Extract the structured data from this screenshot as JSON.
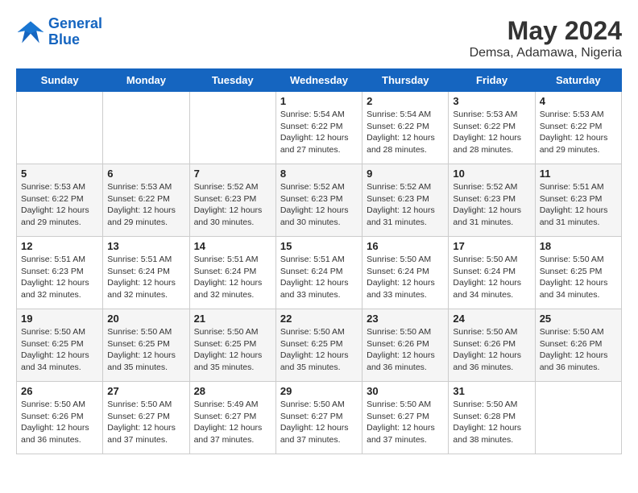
{
  "logo": {
    "line1": "General",
    "line2": "Blue"
  },
  "title": {
    "month_year": "May 2024",
    "location": "Demsa, Adamawa, Nigeria"
  },
  "days_of_week": [
    "Sunday",
    "Monday",
    "Tuesday",
    "Wednesday",
    "Thursday",
    "Friday",
    "Saturday"
  ],
  "weeks": [
    [
      {
        "day": "",
        "info": ""
      },
      {
        "day": "",
        "info": ""
      },
      {
        "day": "",
        "info": ""
      },
      {
        "day": "1",
        "info": "Sunrise: 5:54 AM\nSunset: 6:22 PM\nDaylight: 12 hours\nand 27 minutes."
      },
      {
        "day": "2",
        "info": "Sunrise: 5:54 AM\nSunset: 6:22 PM\nDaylight: 12 hours\nand 28 minutes."
      },
      {
        "day": "3",
        "info": "Sunrise: 5:53 AM\nSunset: 6:22 PM\nDaylight: 12 hours\nand 28 minutes."
      },
      {
        "day": "4",
        "info": "Sunrise: 5:53 AM\nSunset: 6:22 PM\nDaylight: 12 hours\nand 29 minutes."
      }
    ],
    [
      {
        "day": "5",
        "info": "Sunrise: 5:53 AM\nSunset: 6:22 PM\nDaylight: 12 hours\nand 29 minutes."
      },
      {
        "day": "6",
        "info": "Sunrise: 5:53 AM\nSunset: 6:22 PM\nDaylight: 12 hours\nand 29 minutes."
      },
      {
        "day": "7",
        "info": "Sunrise: 5:52 AM\nSunset: 6:23 PM\nDaylight: 12 hours\nand 30 minutes."
      },
      {
        "day": "8",
        "info": "Sunrise: 5:52 AM\nSunset: 6:23 PM\nDaylight: 12 hours\nand 30 minutes."
      },
      {
        "day": "9",
        "info": "Sunrise: 5:52 AM\nSunset: 6:23 PM\nDaylight: 12 hours\nand 31 minutes."
      },
      {
        "day": "10",
        "info": "Sunrise: 5:52 AM\nSunset: 6:23 PM\nDaylight: 12 hours\nand 31 minutes."
      },
      {
        "day": "11",
        "info": "Sunrise: 5:51 AM\nSunset: 6:23 PM\nDaylight: 12 hours\nand 31 minutes."
      }
    ],
    [
      {
        "day": "12",
        "info": "Sunrise: 5:51 AM\nSunset: 6:23 PM\nDaylight: 12 hours\nand 32 minutes."
      },
      {
        "day": "13",
        "info": "Sunrise: 5:51 AM\nSunset: 6:24 PM\nDaylight: 12 hours\nand 32 minutes."
      },
      {
        "day": "14",
        "info": "Sunrise: 5:51 AM\nSunset: 6:24 PM\nDaylight: 12 hours\nand 32 minutes."
      },
      {
        "day": "15",
        "info": "Sunrise: 5:51 AM\nSunset: 6:24 PM\nDaylight: 12 hours\nand 33 minutes."
      },
      {
        "day": "16",
        "info": "Sunrise: 5:50 AM\nSunset: 6:24 PM\nDaylight: 12 hours\nand 33 minutes."
      },
      {
        "day": "17",
        "info": "Sunrise: 5:50 AM\nSunset: 6:24 PM\nDaylight: 12 hours\nand 34 minutes."
      },
      {
        "day": "18",
        "info": "Sunrise: 5:50 AM\nSunset: 6:25 PM\nDaylight: 12 hours\nand 34 minutes."
      }
    ],
    [
      {
        "day": "19",
        "info": "Sunrise: 5:50 AM\nSunset: 6:25 PM\nDaylight: 12 hours\nand 34 minutes."
      },
      {
        "day": "20",
        "info": "Sunrise: 5:50 AM\nSunset: 6:25 PM\nDaylight: 12 hours\nand 35 minutes."
      },
      {
        "day": "21",
        "info": "Sunrise: 5:50 AM\nSunset: 6:25 PM\nDaylight: 12 hours\nand 35 minutes."
      },
      {
        "day": "22",
        "info": "Sunrise: 5:50 AM\nSunset: 6:25 PM\nDaylight: 12 hours\nand 35 minutes."
      },
      {
        "day": "23",
        "info": "Sunrise: 5:50 AM\nSunset: 6:26 PM\nDaylight: 12 hours\nand 36 minutes."
      },
      {
        "day": "24",
        "info": "Sunrise: 5:50 AM\nSunset: 6:26 PM\nDaylight: 12 hours\nand 36 minutes."
      },
      {
        "day": "25",
        "info": "Sunrise: 5:50 AM\nSunset: 6:26 PM\nDaylight: 12 hours\nand 36 minutes."
      }
    ],
    [
      {
        "day": "26",
        "info": "Sunrise: 5:50 AM\nSunset: 6:26 PM\nDaylight: 12 hours\nand 36 minutes."
      },
      {
        "day": "27",
        "info": "Sunrise: 5:50 AM\nSunset: 6:27 PM\nDaylight: 12 hours\nand 37 minutes."
      },
      {
        "day": "28",
        "info": "Sunrise: 5:49 AM\nSunset: 6:27 PM\nDaylight: 12 hours\nand 37 minutes."
      },
      {
        "day": "29",
        "info": "Sunrise: 5:50 AM\nSunset: 6:27 PM\nDaylight: 12 hours\nand 37 minutes."
      },
      {
        "day": "30",
        "info": "Sunrise: 5:50 AM\nSunset: 6:27 PM\nDaylight: 12 hours\nand 37 minutes."
      },
      {
        "day": "31",
        "info": "Sunrise: 5:50 AM\nSunset: 6:28 PM\nDaylight: 12 hours\nand 38 minutes."
      },
      {
        "day": "",
        "info": ""
      }
    ]
  ]
}
